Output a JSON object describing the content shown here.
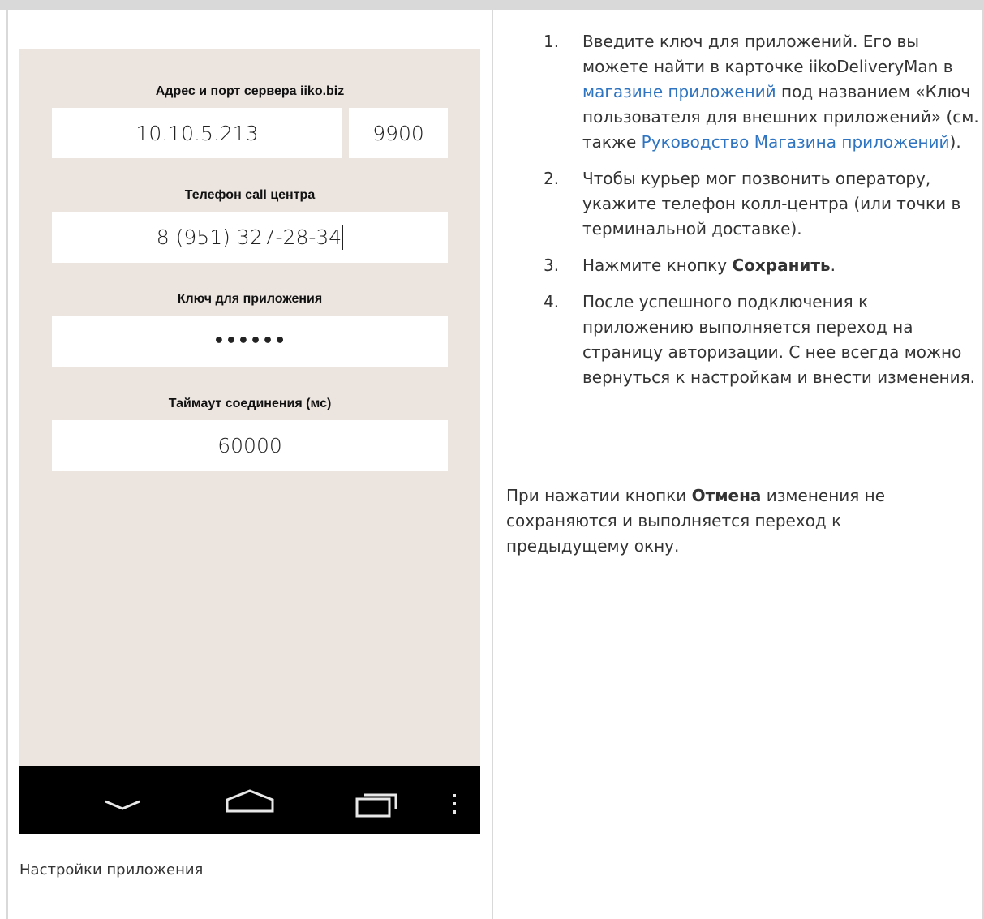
{
  "phone": {
    "server_label": "Адрес и порт сервера iiko.biz",
    "server_address": "10.10.5.213",
    "server_port": "9900",
    "phone_label": "Телефон call центра",
    "phone_value": "8 (951) 327-28-34",
    "key_label": "Ключ для приложения",
    "key_value": "••••••",
    "timeout_label": "Таймаут соединения (мс)",
    "timeout_value": "60000",
    "nav": {
      "back_icon": "chevron-down-icon",
      "home_icon": "home-icon",
      "recents_icon": "recents-icon",
      "menu_icon": "more-vert-icon"
    }
  },
  "caption": "Настройки приложения",
  "steps": [
    {
      "num": "1.",
      "t1": "Введите ключ для приложений. Его вы можете найти в карточке iikoDeliveryMan в ",
      "link1": "магазине приложений",
      "t2": " под названием «Ключ пользователя для внешних приложений» (см. также ",
      "link2": "Руководство Магазина приложений",
      "t3": ")."
    },
    {
      "num": "2.",
      "text": "Чтобы курьер мог позвонить оператору, укажите телефон колл-центра (или точки в терминальной доставке)."
    },
    {
      "num": "3.",
      "pre": " Нажмите кнопку ",
      "bold": "Сохранить",
      "post": "."
    },
    {
      "num": "4.",
      "text": "После успешного подключения к приложению выполняется переход на страницу авторизации. С нее всегда можно вернуться к настройкам и внести изменения."
    }
  ],
  "note": {
    "pre": "При нажатии кнопки ",
    "bold": "Отмена",
    "post": " изменения не сохраняются и выполняется переход к предыдущему окну."
  },
  "colors": {
    "phone_bg": "#ebe4df",
    "link": "#2f74c0",
    "navbar": "#000000"
  }
}
